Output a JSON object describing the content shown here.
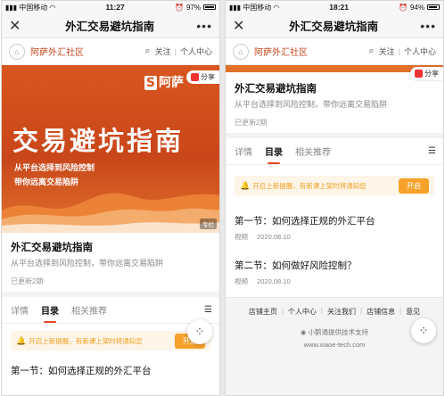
{
  "left": {
    "status": {
      "carrier": "中国移动",
      "time": "11:27",
      "battery": "97%",
      "battery_level": 0.97
    },
    "titlebar": {
      "title": "外汇交易避坑指南",
      "close": "✕",
      "more": "•••"
    },
    "community": {
      "name": "阿萨外汇社区",
      "follow": "关注",
      "personal": "个人中心"
    },
    "banner": {
      "brand": "阿萨",
      "share": "分享",
      "headline": "交易避坑指南",
      "sub1": "从平台选择到风险控制",
      "sub2": "带你远离交易陷阱",
      "tag": "专栏"
    },
    "course": {
      "title": "外汇交易避坑指南",
      "desc": "从平台选择到风险控制，带你远离交易陷阱",
      "updated": "已更新2期"
    },
    "tabs": [
      {
        "label": "详情"
      },
      {
        "label": "目录"
      },
      {
        "label": "相关推荐"
      }
    ],
    "notify": {
      "text": "开启上新提醒，有新课上架时将通知您",
      "button": "开启"
    },
    "lessons": [
      {
        "title": "第一节：如何选择正规的外汇平台"
      }
    ]
  },
  "right": {
    "status": {
      "carrier": "中国移动",
      "time": "18:21",
      "battery": "94%",
      "battery_level": 0.94
    },
    "titlebar": {
      "title": "外汇交易避坑指南",
      "close": "✕",
      "more": "•••"
    },
    "community": {
      "name": "阿萨外汇社区",
      "follow": "关注",
      "personal": "个人中心"
    },
    "share": "分享",
    "course": {
      "title": "外汇交易避坑指南",
      "desc": "从平台选择到风险控制，带你远离交易陷阱",
      "updated": "已更新2期"
    },
    "tabs": [
      {
        "label": "详情"
      },
      {
        "label": "目录"
      },
      {
        "label": "相关推荐"
      }
    ],
    "notify": {
      "text": "开启上新提醒，有新课上架时将通知您",
      "button": "开启"
    },
    "lessons": [
      {
        "title": "第一节：如何选择正规的外汇平台",
        "type": "视频",
        "date": "2020.08.10"
      },
      {
        "title": "第二节：如何做好风险控制？",
        "type": "视频",
        "date": "2020.08.10"
      }
    ],
    "footer": {
      "links": [
        "店铺主页",
        "个人中心",
        "关注我们",
        "店铺信息",
        "意见"
      ],
      "support": "小鹅通提供技术支持",
      "site": "www.xiaoe-tech.com"
    }
  },
  "colors": {
    "accent": "#e0482a",
    "banner": "#d9561f",
    "notify_bg": "#fdf5e8",
    "notify_text": "#f0a020",
    "notify_btn": "#f7a32b"
  }
}
